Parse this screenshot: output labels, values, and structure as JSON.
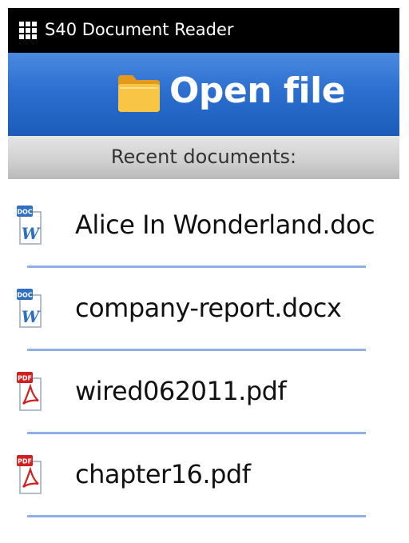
{
  "status_bar": {
    "app_title": "S40 Document Reader",
    "icon": "app-grid-icon"
  },
  "header": {
    "open_label": "Open file",
    "icon": "folder-icon"
  },
  "recent": {
    "label": "Recent documents:"
  },
  "files": [
    {
      "name": "Alice In Wonderland.doc",
      "type": "doc",
      "icon": "word-doc-icon"
    },
    {
      "name": "company-report.docx",
      "type": "doc",
      "icon": "word-doc-icon"
    },
    {
      "name": "wired062011.pdf",
      "type": "pdf",
      "icon": "pdf-icon"
    },
    {
      "name": "chapter16.pdf",
      "type": "pdf",
      "icon": "pdf-icon"
    }
  ],
  "icon_badges": {
    "doc": "DOC",
    "pdf": "PDF"
  },
  "colors": {
    "header_blue": "#2c6fd0",
    "separator": "#8db1e8",
    "pdf_red": "#d21f1f",
    "doc_blue": "#2f6fc4"
  }
}
